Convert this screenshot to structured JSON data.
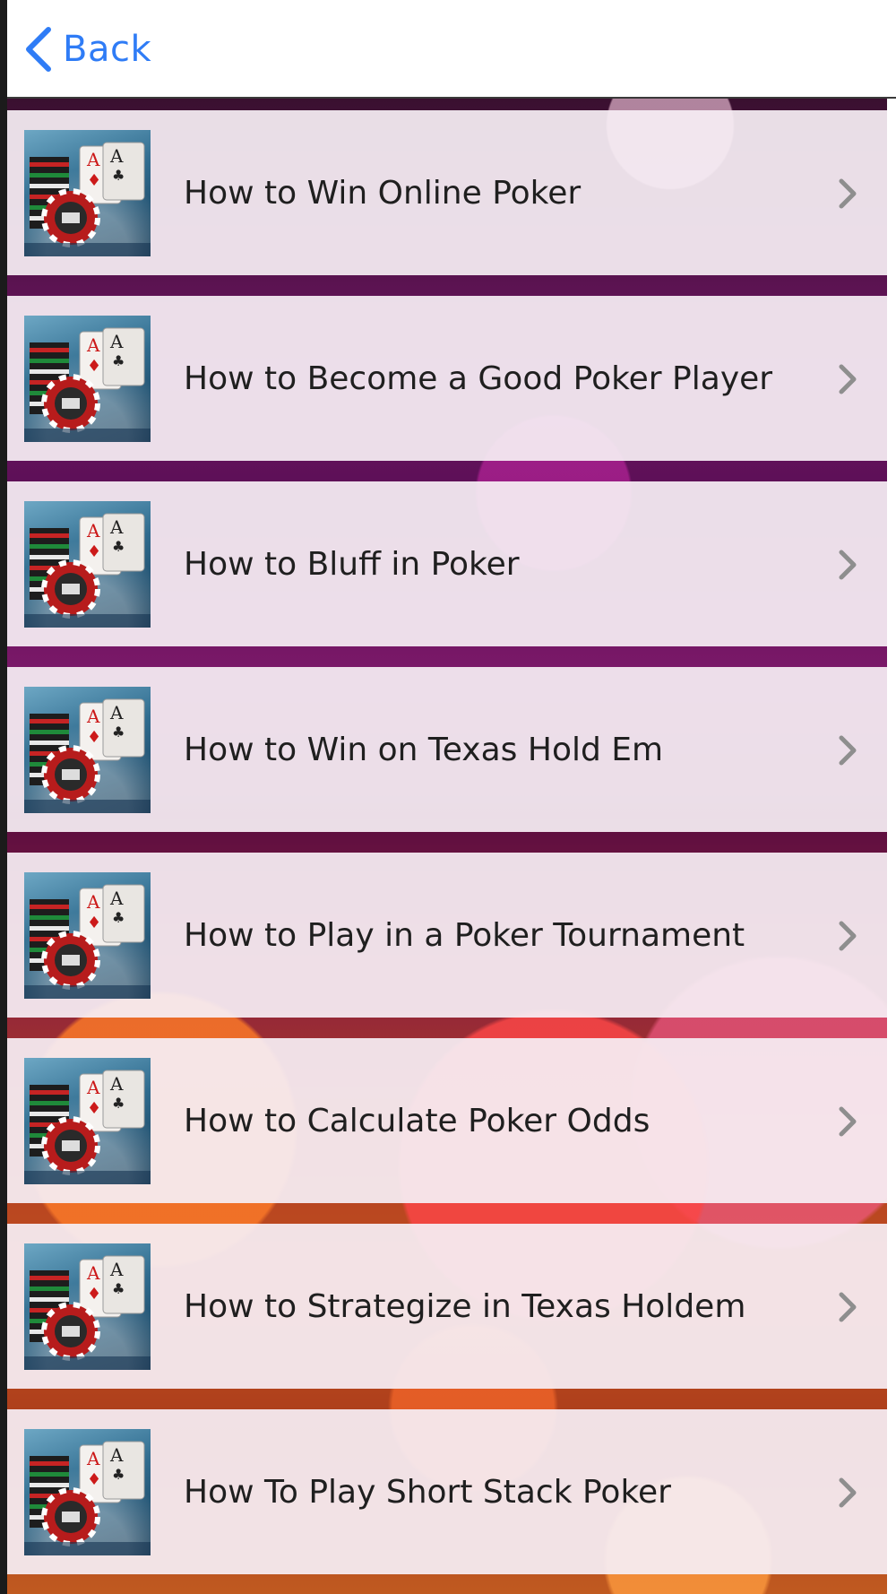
{
  "nav": {
    "back_label": "Back",
    "accent_color": "#2f7cf6"
  },
  "list": {
    "items": [
      {
        "label": "How to Win Online Poker"
      },
      {
        "label": "How to Become a Good Poker Player"
      },
      {
        "label": "How to Bluff in Poker"
      },
      {
        "label": "How to Win on Texas Hold Em"
      },
      {
        "label": "How to Play in a Poker Tournament"
      },
      {
        "label": "How to Calculate Poker Odds"
      },
      {
        "label": "How to Strategize in Texas Holdem"
      },
      {
        "label": "How To Play Short Stack Poker"
      }
    ],
    "thumbnail_icon": "poker-chips-aces-thumbnail",
    "row_indicator_icon": "chevron-right-icon"
  }
}
